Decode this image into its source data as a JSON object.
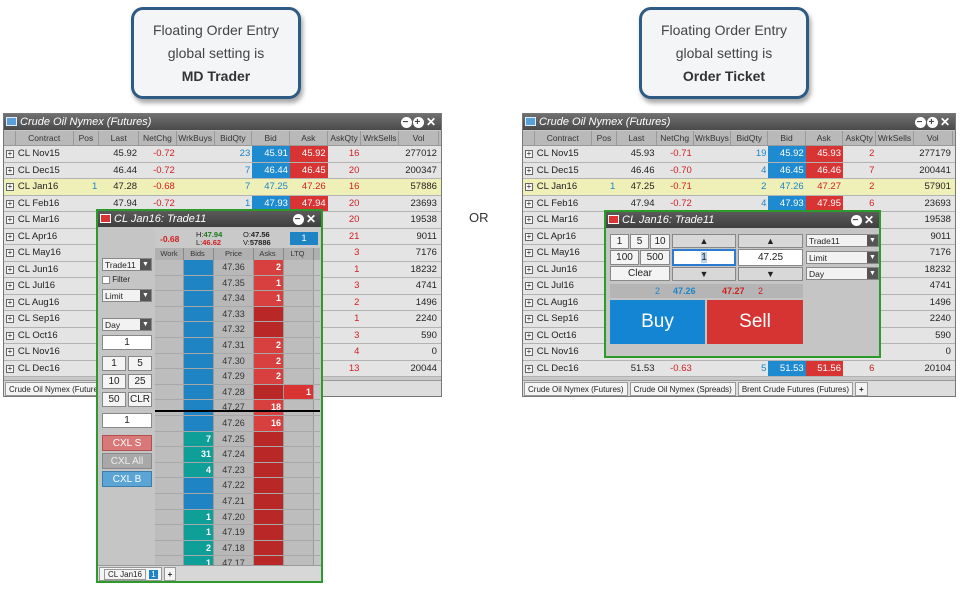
{
  "callouts": {
    "left": {
      "line1": "Floating Order Entry",
      "line2": "global setting is",
      "setting": "MD Trader"
    },
    "right": {
      "line1": "Floating Order Entry",
      "line2": "global setting is",
      "setting": "Order Ticket"
    }
  },
  "or_label": "OR",
  "market_grid": {
    "title": "Crude Oil Nymex (Futures)",
    "columns": [
      "Contract",
      "Pos",
      "Last",
      "NetChg",
      "WrkBuys",
      "BidQty",
      "Bid",
      "Ask",
      "AskQty",
      "WrkSells",
      "Vol"
    ],
    "left_rows": [
      {
        "contract": "CL Nov15",
        "pos": "",
        "last": "45.92",
        "netchg": "-0.72",
        "bidqty": "23",
        "bid": "45.91",
        "ask": "45.92",
        "askqty": "16",
        "vol": "277012"
      },
      {
        "contract": "CL Dec15",
        "pos": "",
        "last": "46.44",
        "netchg": "-0.72",
        "bidqty": "7",
        "bid": "46.44",
        "ask": "46.45",
        "askqty": "20",
        "vol": "200347"
      },
      {
        "contract": "CL Jan16",
        "pos": "1",
        "last": "47.28",
        "netchg": "-0.68",
        "bidqty": "7",
        "bid": "47.25",
        "ask": "47.26",
        "askqty": "16",
        "vol": "57886"
      },
      {
        "contract": "CL Feb16",
        "pos": "",
        "last": "47.94",
        "netchg": "-0.72",
        "bidqty": "1",
        "bid": "47.93",
        "ask": "47.94",
        "askqty": "20",
        "vol": "23693"
      },
      {
        "contract": "CL Mar16",
        "pos": "",
        "last": "",
        "netchg": "",
        "bidqty": "",
        "bid": "",
        "ask": "",
        "askqty": "20",
        "vol": "19538"
      },
      {
        "contract": "CL Apr16",
        "pos": "",
        "last": "",
        "netchg": "",
        "bidqty": "",
        "bid": "",
        "ask": "",
        "askqty": "21",
        "vol": "9011"
      },
      {
        "contract": "CL May16",
        "pos": "",
        "last": "",
        "netchg": "",
        "bidqty": "",
        "bid": "",
        "ask": "",
        "askqty": "3",
        "vol": "7176"
      },
      {
        "contract": "CL Jun16",
        "pos": "",
        "last": "",
        "netchg": "",
        "bidqty": "",
        "bid": "",
        "ask": "",
        "askqty": "1",
        "vol": "18232"
      },
      {
        "contract": "CL Jul16",
        "pos": "",
        "last": "",
        "netchg": "",
        "bidqty": "",
        "bid": "",
        "ask": "",
        "askqty": "3",
        "vol": "4741"
      },
      {
        "contract": "CL Aug16",
        "pos": "",
        "last": "",
        "netchg": "",
        "bidqty": "",
        "bid": "",
        "ask": "",
        "askqty": "2",
        "vol": "1496"
      },
      {
        "contract": "CL Sep16",
        "pos": "",
        "last": "",
        "netchg": "",
        "bidqty": "",
        "bid": "",
        "ask": "",
        "askqty": "1",
        "vol": "2240"
      },
      {
        "contract": "CL Oct16",
        "pos": "",
        "last": "",
        "netchg": "",
        "bidqty": "",
        "bid": "",
        "ask": "",
        "askqty": "3",
        "vol": "590"
      },
      {
        "contract": "CL Nov16",
        "pos": "",
        "last": "",
        "netchg": "",
        "bidqty": "",
        "bid": "",
        "ask": "",
        "askqty": "4",
        "vol": "0"
      },
      {
        "contract": "CL Dec16",
        "pos": "",
        "last": "",
        "netchg": "",
        "bidqty": "",
        "bid": "",
        "ask": "",
        "askqty": "13",
        "vol": "20044"
      }
    ],
    "right_rows": [
      {
        "contract": "CL Nov15",
        "pos": "",
        "last": "45.93",
        "netchg": "-0.71",
        "bidqty": "19",
        "bid": "45.92",
        "ask": "45.93",
        "askqty": "2",
        "vol": "277179"
      },
      {
        "contract": "CL Dec15",
        "pos": "",
        "last": "46.46",
        "netchg": "-0.70",
        "bidqty": "4",
        "bid": "46.45",
        "ask": "46.46",
        "askqty": "7",
        "vol": "200441"
      },
      {
        "contract": "CL Jan16",
        "pos": "1",
        "last": "47.25",
        "netchg": "-0.71",
        "bidqty": "2",
        "bid": "47.26",
        "ask": "47.27",
        "askqty": "2",
        "vol": "57901"
      },
      {
        "contract": "CL Feb16",
        "pos": "",
        "last": "47.94",
        "netchg": "-0.72",
        "bidqty": "4",
        "bid": "47.93",
        "ask": "47.95",
        "askqty": "6",
        "vol": "23693"
      },
      {
        "contract": "CL Mar16",
        "pos": "",
        "last": "",
        "netchg": "",
        "bidqty": "",
        "bid": "",
        "ask": "",
        "askqty": "",
        "vol": "19538"
      },
      {
        "contract": "CL Apr16",
        "pos": "",
        "last": "",
        "netchg": "",
        "bidqty": "",
        "bid": "",
        "ask": "",
        "askqty": "",
        "vol": "9011"
      },
      {
        "contract": "CL May16",
        "pos": "",
        "last": "",
        "netchg": "",
        "bidqty": "",
        "bid": "",
        "ask": "",
        "askqty": "",
        "vol": "7176"
      },
      {
        "contract": "CL Jun16",
        "pos": "",
        "last": "",
        "netchg": "",
        "bidqty": "",
        "bid": "",
        "ask": "",
        "askqty": "",
        "vol": "18232"
      },
      {
        "contract": "CL Jul16",
        "pos": "",
        "last": "",
        "netchg": "",
        "bidqty": "",
        "bid": "",
        "ask": "",
        "askqty": "",
        "vol": "4741"
      },
      {
        "contract": "CL Aug16",
        "pos": "",
        "last": "",
        "netchg": "",
        "bidqty": "",
        "bid": "",
        "ask": "",
        "askqty": "",
        "vol": "1496"
      },
      {
        "contract": "CL Sep16",
        "pos": "",
        "last": "",
        "netchg": "",
        "bidqty": "",
        "bid": "",
        "ask": "",
        "askqty": "",
        "vol": "2240"
      },
      {
        "contract": "CL Oct16",
        "pos": "",
        "last": "",
        "netchg": "",
        "bidqty": "",
        "bid": "",
        "ask": "",
        "askqty": "",
        "vol": "590"
      },
      {
        "contract": "CL Nov16",
        "pos": "",
        "last": "",
        "netchg": "",
        "bidqty": "",
        "bid": "",
        "ask": "",
        "askqty": "",
        "vol": "0"
      },
      {
        "contract": "CL Dec16",
        "pos": "",
        "last": "51.53",
        "netchg": "-0.63",
        "bidqty": "5",
        "bid": "51.53",
        "ask": "51.56",
        "askqty": "6",
        "vol": "20104"
      }
    ],
    "left_tabs": [
      "Crude Oil Nymex (Futures)"
    ],
    "right_tabs": [
      "Crude Oil Nymex (Futures)",
      "Crude Oil Nymex (Spreads)",
      "Brent Crude Futures (Futures)"
    ],
    "plus": "+"
  },
  "md_trader": {
    "title": "CL Jan16: Trade11",
    "netchg": "-0.68",
    "high": "47.94",
    "low": "46.62",
    "open": "47.56",
    "volume": "57886",
    "h_label": "H:",
    "l_label": "L:",
    "o_label": "O:",
    "v_label": "V:",
    "pos": "1",
    "account": "Trade11",
    "filter": "Filter",
    "order_type": "Limit",
    "tif": "Day",
    "qty": "1",
    "qty_buttons": [
      "1",
      "5",
      "10",
      "25",
      "50",
      "CLR"
    ],
    "qty2": "1",
    "cxl_s": "CXL S",
    "cxl_all": "CXL All",
    "cxl_b": "CXL B",
    "headers": [
      "Work",
      "Bids",
      "Price",
      "Asks",
      "LTQ"
    ],
    "ladder": [
      {
        "price": "47.36",
        "bid": "",
        "ask": "2",
        "ltq": ""
      },
      {
        "price": "47.35",
        "bid": "",
        "ask": "1",
        "ltq": ""
      },
      {
        "price": "47.34",
        "bid": "",
        "ask": "1",
        "ltq": ""
      },
      {
        "price": "47.33",
        "bid": "",
        "ask": "",
        "ltq": ""
      },
      {
        "price": "47.32",
        "bid": "",
        "ask": "",
        "ltq": ""
      },
      {
        "price": "47.31",
        "bid": "",
        "ask": "2",
        "ltq": ""
      },
      {
        "price": "47.30",
        "bid": "",
        "ask": "2",
        "ltq": ""
      },
      {
        "price": "47.29",
        "bid": "",
        "ask": "2",
        "ltq": ""
      },
      {
        "price": "47.28",
        "bid": "",
        "ask": "",
        "ltq": "1"
      },
      {
        "price": "47.27",
        "bid": "",
        "ask": "18",
        "ltq": ""
      },
      {
        "price": "47.26",
        "bid": "",
        "ask": "16",
        "ltq": ""
      },
      {
        "price": "47.25",
        "bid": "7",
        "ask": "",
        "ltq": ""
      },
      {
        "price": "47.24",
        "bid": "31",
        "ask": "",
        "ltq": ""
      },
      {
        "price": "47.23",
        "bid": "4",
        "ask": "",
        "ltq": ""
      },
      {
        "price": "47.22",
        "bid": "",
        "ask": "",
        "ltq": ""
      },
      {
        "price": "47.21",
        "bid": "",
        "ask": "",
        "ltq": ""
      },
      {
        "price": "47.20",
        "bid": "1",
        "ask": "",
        "ltq": ""
      },
      {
        "price": "47.19",
        "bid": "1",
        "ask": "",
        "ltq": ""
      },
      {
        "price": "47.18",
        "bid": "2",
        "ask": "",
        "ltq": ""
      },
      {
        "price": "47.17",
        "bid": "1",
        "ask": "",
        "ltq": ""
      }
    ],
    "tab": "CL Jan16",
    "tab_badge": "1",
    "tab_plus": "+"
  },
  "order_ticket": {
    "title": "CL Jan16: Trade11",
    "qty_buttons": [
      "1",
      "5",
      "10",
      "100",
      "500"
    ],
    "clear": "Clear",
    "qty": "1",
    "price": "47.25",
    "account": "Trade11",
    "order_type": "Limit",
    "tif": "Day",
    "bidqty": "2",
    "bid": "47.26",
    "ask": "47.27",
    "askqty": "2",
    "buy": "Buy",
    "sell": "Sell"
  },
  "colors": {
    "bid": "#1e8ad0",
    "ask": "#d93434",
    "floating_border": "#2c9b2c",
    "callout_border": "#2d5b84"
  }
}
